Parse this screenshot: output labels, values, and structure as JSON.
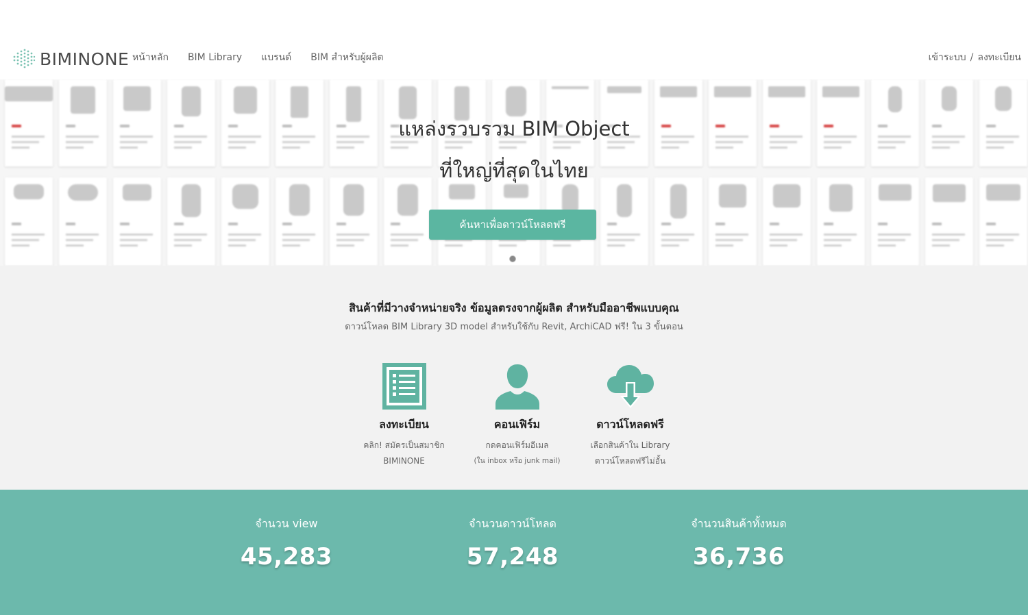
{
  "header": {
    "logo_text": "BIMINONE",
    "nav": [
      {
        "label": "หน้าหลัก"
      },
      {
        "label": "BIM Library"
      },
      {
        "label": "แบรนด์"
      },
      {
        "label": "BIM สำหรับผู้ผลิต"
      }
    ],
    "login_label": "เข้าระบบ",
    "separator": "/",
    "register_label": "ลงทะเบียน"
  },
  "hero": {
    "title_line1": "แหล่งรวบรวม BIM Object",
    "title_line2": "ที่ใหญ่ที่สุดในไทย",
    "button_label": "ค้นหาเพื่อดาวน์โหลดฟรี"
  },
  "info": {
    "headline": "สินค้าที่มีวางจำหน่ายจริง ข้อมูลตรงจากผู้ผลิต สำหรับมืออาชีพแบบคุณ",
    "subline": "ดาวน์โหลด BIM Library 3D model สำหรับใช้กับ Revit, ArchiCAD ฟรี! ใน 3 ขั้นตอน",
    "steps": [
      {
        "icon": "list-icon",
        "title": "ลงทะเบียน",
        "desc1": "คลิก! สมัครเป็นสมาชิก",
        "desc2": "BIMINONE"
      },
      {
        "icon": "user-icon",
        "title": "คอนเฟิร์ม",
        "desc1": "กดคอนเฟิร์มอีเมล",
        "desc2": "(ใน inbox หรือ junk mail)"
      },
      {
        "icon": "cloud-download-icon",
        "title": "ดาวน์โหลดฟรี",
        "desc1": "เลือกสินค้าใน Library",
        "desc2": "ดาวน์โหลดฟรีไม่อั้น"
      }
    ]
  },
  "stats": [
    {
      "label": "จำนวน view",
      "value": "45,283"
    },
    {
      "label": "จำนวนดาวน์โหลด",
      "value": "57,248"
    },
    {
      "label": "จำนวนสินค้าทั้งหมด",
      "value": "36,736"
    }
  ],
  "colors": {
    "accent": "#5bb6a1",
    "stats_background": "#6cb9ac",
    "icon_teal": "#5fb3a1"
  }
}
